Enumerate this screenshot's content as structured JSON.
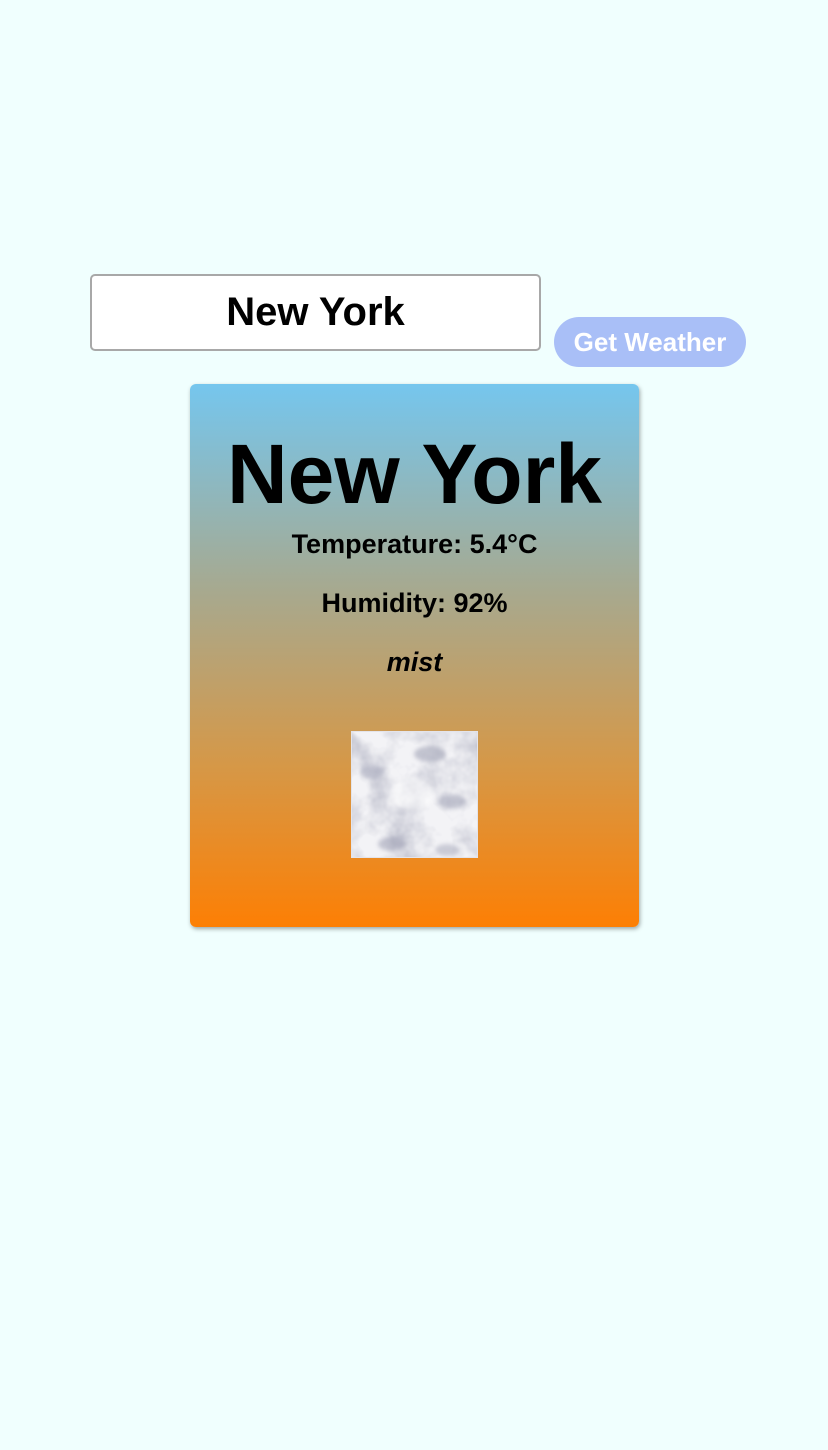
{
  "search": {
    "value": "New York"
  },
  "actions": {
    "get_weather_label": "Get Weather"
  },
  "weather": {
    "city": "New York",
    "temperature_text": "Temperature: 5.4°C",
    "humidity_text": "Humidity: 92%",
    "description": "mist",
    "icon": "mist-icon"
  },
  "colors": {
    "page_background": "#f0fffe",
    "button_background": "#a9bff7",
    "card_gradient_top": "#75c6ee",
    "card_gradient_bottom": "#fd7f04"
  }
}
